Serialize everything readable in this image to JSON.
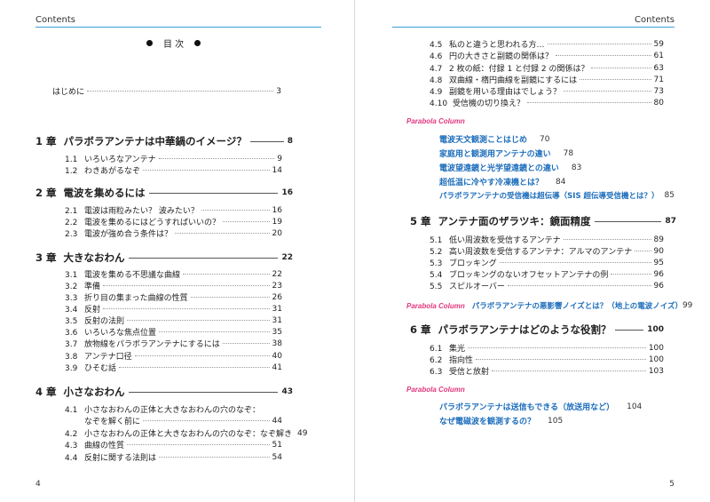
{
  "left": {
    "header": "Contents",
    "page_number": "4",
    "toc_title": "目 次",
    "intro": {
      "label": "はじめに",
      "page": "3"
    },
    "chapters": [
      {
        "num": "1 章",
        "title": "パラボラアンテナは中華鍋のイメージ？",
        "page": "8",
        "sections": [
          {
            "num": "1.1",
            "title": "いろいろなアンテナ",
            "page": "9"
          },
          {
            "num": "1.2",
            "title": "わきあがるなぞ",
            "page": "14"
          }
        ]
      },
      {
        "num": "2 章",
        "title": "電波を集めるには",
        "page": "16",
        "sections": [
          {
            "num": "2.1",
            "title": "電波は雨粒みたい？ 波みたい？",
            "page": "16"
          },
          {
            "num": "2.2",
            "title": "電波を集めるにはどうすればいいの？",
            "page": "19"
          },
          {
            "num": "2.3",
            "title": "電波が強め合う条件は？",
            "page": "20"
          }
        ]
      },
      {
        "num": "3 章",
        "title": "大きなおわん",
        "page": "22",
        "sections": [
          {
            "num": "3.1",
            "title": "電波を集める不思議な曲線",
            "page": "22"
          },
          {
            "num": "3.2",
            "title": "準備",
            "page": "23"
          },
          {
            "num": "3.3",
            "title": "折り目の集まった曲線の性質",
            "page": "26"
          },
          {
            "num": "3.4",
            "title": "反射",
            "page": "31"
          },
          {
            "num": "3.5",
            "title": "反射の法則",
            "page": "31"
          },
          {
            "num": "3.6",
            "title": "いろいろな焦点位置",
            "page": "35"
          },
          {
            "num": "3.7",
            "title": "放物線をパラボラアンテナにするには",
            "page": "38"
          },
          {
            "num": "3.8",
            "title": "アンテナ口径",
            "page": "40"
          },
          {
            "num": "3.9",
            "title": "ひそむ話",
            "page": "41"
          }
        ]
      },
      {
        "num": "4 章",
        "title": "小さなおわん",
        "page": "43",
        "sections": [
          {
            "num": "4.1",
            "title": "小さなおわんの正体と大きなおわんの穴のなぞ：",
            "title2": "なぞを解く前に",
            "page": "44"
          },
          {
            "num": "4.2",
            "title": "小さなおわんの正体と大きなおわんの穴のなぞ：なぞ解き",
            "page": "49"
          },
          {
            "num": "4.3",
            "title": "曲線の性質",
            "page": "51"
          },
          {
            "num": "4.4",
            "title": "反射に関する法則は",
            "page": "54"
          }
        ]
      }
    ]
  },
  "right": {
    "header": "Contents",
    "page_number": "5",
    "top_sections": [
      {
        "num": "4.5",
        "title": "私のと違うと思われる方…",
        "page": "59"
      },
      {
        "num": "4.6",
        "title": "円の大きさと副鏡の関係は？",
        "page": "61"
      },
      {
        "num": "4.7",
        "title": "2 枚の紙：付録 1 と付録 2 の関係は？",
        "page": "63"
      },
      {
        "num": "4.8",
        "title": "双曲線・楕円曲線を副鏡にするには",
        "page": "71"
      },
      {
        "num": "4.9",
        "title": "副鏡を用いる理由はでしょう？",
        "page": "73"
      },
      {
        "num": "4.10",
        "title": "受信機の切り換え？",
        "page": "80"
      }
    ],
    "column_label": "Parabola Column",
    "column1": [
      {
        "title": "電波天文観測ことはじめ",
        "page": "70"
      },
      {
        "title": "家庭用と観測用アンテナの違い",
        "page": "78"
      },
      {
        "title": "電波望遠鏡と光学望遠鏡との違い",
        "page": "83"
      },
      {
        "title": "超低温に冷やす冷凍機とは？",
        "page": "84"
      },
      {
        "title": "パラボラアンテナの受信機は超伝導（SIS 超伝導受信機とは？）",
        "page": "85"
      }
    ],
    "chapter5": {
      "num": "5 章",
      "title": "アンテナ面のザラツキ：鏡面精度",
      "page": "87",
      "sections": [
        {
          "num": "5.1",
          "title": "低い周波数を受信するアンテナ",
          "page": "89"
        },
        {
          "num": "5.2",
          "title": "高い周波数を受信するアンテナ：アルマのアンテナ",
          "page": "90"
        },
        {
          "num": "5.3",
          "title": "ブロッキング",
          "page": "95"
        },
        {
          "num": "5.4",
          "title": "ブロッキングのないオフセットアンテナの例",
          "page": "96"
        },
        {
          "num": "5.5",
          "title": "スピルオーバー",
          "page": "96"
        }
      ]
    },
    "column2": {
      "title": "パラボラアンテナの悪影響ノイズとは？（地上の電波ノイズ）",
      "page": "99"
    },
    "chapter6": {
      "num": "6 章",
      "title": "パラボラアンテナはどのような役割？",
      "page": "100",
      "sections": [
        {
          "num": "6.1",
          "title": "集光",
          "page": "100"
        },
        {
          "num": "6.2",
          "title": "指向性",
          "page": "100"
        },
        {
          "num": "6.3",
          "title": "受信と放射",
          "page": "103"
        }
      ]
    },
    "column3": [
      {
        "title": "パラボラアンテナは送信もできる（放送用など）",
        "page": "104"
      },
      {
        "title": "なぜ電磁波を観測するの？",
        "page": "105"
      }
    ]
  }
}
